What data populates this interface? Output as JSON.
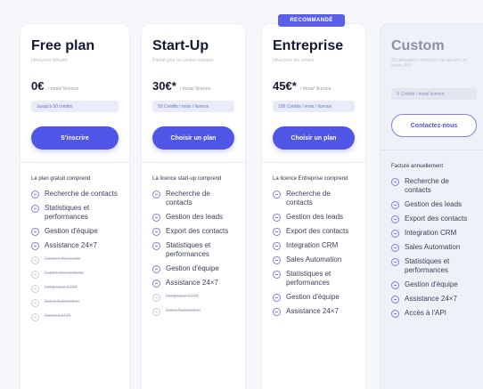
{
  "badge": "RECOMMANDÉ",
  "plans": [
    {
      "title": "Free plan",
      "subtitle": "Idéal pour débuter",
      "price": "0€",
      "period": "/ mois/ licence",
      "credits": "Jusqu'à 50 crédits",
      "cta": "S'inscrire",
      "intro": "Le plan gratuit comprend",
      "features": [
        {
          "label": "Recherche de contacts",
          "enabled": true
        },
        {
          "label": "Statistiques et performances",
          "enabled": true
        },
        {
          "label": "Gestion d'équipe",
          "enabled": true
        },
        {
          "label": "Assistance 24×7",
          "enabled": true
        },
        {
          "label": "Gestion des leads",
          "enabled": false
        },
        {
          "label": "Export des contacts",
          "enabled": false
        },
        {
          "label": "Intégration CRM",
          "enabled": false
        },
        {
          "label": "Sales Automation",
          "enabled": false
        },
        {
          "label": "Accès à l'API",
          "enabled": false
        }
      ]
    },
    {
      "title": "Start-Up",
      "subtitle": "Parfait pour les petites équipes",
      "price": "30€*",
      "period": "/ mois/ licence",
      "credits": "50 Crédits / mois / licence",
      "cta": "Choisir un plan",
      "intro": "La licence start-up comprend",
      "features": [
        {
          "label": "Recherche de contacts",
          "enabled": true
        },
        {
          "label": "Gestion des leads",
          "enabled": true
        },
        {
          "label": "Export des contacts",
          "enabled": true
        },
        {
          "label": "Statistiques et performances",
          "enabled": true
        },
        {
          "label": "Gestion d'équipe",
          "enabled": true
        },
        {
          "label": "Assistance 24×7",
          "enabled": true
        },
        {
          "label": "Intégration CRM",
          "enabled": false
        },
        {
          "label": "Sales Automation",
          "enabled": false
        }
      ]
    },
    {
      "title": "Entreprise",
      "subtitle": "Idéal pour les ventes",
      "price": "45€*",
      "period": "/ mois/ licence",
      "credits": "100 Crédits / mois / licence",
      "cta": "Choisir un plan",
      "intro": "La licence Entreprise comprend",
      "features": [
        {
          "label": "Recherche de contacts",
          "enabled": true
        },
        {
          "label": "Gestion des leads",
          "enabled": true
        },
        {
          "label": "Export des contacts",
          "enabled": true
        },
        {
          "label": "Integration CRM",
          "enabled": true
        },
        {
          "label": "Sales Automation",
          "enabled": true
        },
        {
          "label": "Statistiques et performances",
          "enabled": true
        },
        {
          "label": "Gestion d'équipe",
          "enabled": true
        },
        {
          "label": "Assistance 24×7",
          "enabled": true
        }
      ]
    },
    {
      "title": "Custom",
      "subtitle": "20 utilisateurs minimum ou utilisent un accès API",
      "price": "",
      "period": "",
      "credits": "X Crédits / mois/ licence",
      "cta": "Contactez-nous",
      "intro": "Facturé annuellement",
      "features": [
        {
          "label": "Recherche de contacts",
          "enabled": true
        },
        {
          "label": "Gestion des leads",
          "enabled": true
        },
        {
          "label": "Export des contacts",
          "enabled": true
        },
        {
          "label": "Integration CRM",
          "enabled": true
        },
        {
          "label": "Sales Automation",
          "enabled": true
        },
        {
          "label": "Statistiques et performances",
          "enabled": true
        },
        {
          "label": "Gestion d'équipe",
          "enabled": true
        },
        {
          "label": "Assistance 24×7",
          "enabled": true
        },
        {
          "label": "Accès à l'API",
          "enabled": true
        }
      ]
    }
  ]
}
